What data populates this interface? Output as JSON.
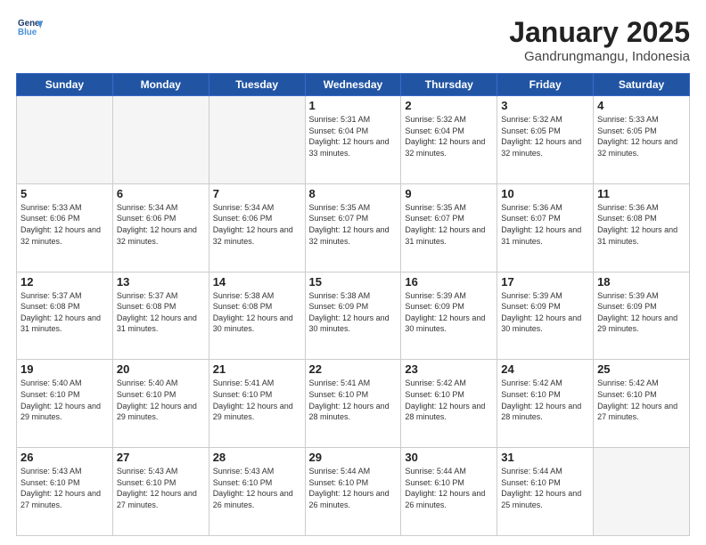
{
  "header": {
    "logo_line1": "General",
    "logo_line2": "Blue",
    "month": "January 2025",
    "location": "Gandrungmangu, Indonesia"
  },
  "weekdays": [
    "Sunday",
    "Monday",
    "Tuesday",
    "Wednesday",
    "Thursday",
    "Friday",
    "Saturday"
  ],
  "weeks": [
    [
      {
        "day": "",
        "info": ""
      },
      {
        "day": "",
        "info": ""
      },
      {
        "day": "",
        "info": ""
      },
      {
        "day": "1",
        "info": "Sunrise: 5:31 AM\nSunset: 6:04 PM\nDaylight: 12 hours\nand 33 minutes."
      },
      {
        "day": "2",
        "info": "Sunrise: 5:32 AM\nSunset: 6:04 PM\nDaylight: 12 hours\nand 32 minutes."
      },
      {
        "day": "3",
        "info": "Sunrise: 5:32 AM\nSunset: 6:05 PM\nDaylight: 12 hours\nand 32 minutes."
      },
      {
        "day": "4",
        "info": "Sunrise: 5:33 AM\nSunset: 6:05 PM\nDaylight: 12 hours\nand 32 minutes."
      }
    ],
    [
      {
        "day": "5",
        "info": "Sunrise: 5:33 AM\nSunset: 6:06 PM\nDaylight: 12 hours\nand 32 minutes."
      },
      {
        "day": "6",
        "info": "Sunrise: 5:34 AM\nSunset: 6:06 PM\nDaylight: 12 hours\nand 32 minutes."
      },
      {
        "day": "7",
        "info": "Sunrise: 5:34 AM\nSunset: 6:06 PM\nDaylight: 12 hours\nand 32 minutes."
      },
      {
        "day": "8",
        "info": "Sunrise: 5:35 AM\nSunset: 6:07 PM\nDaylight: 12 hours\nand 32 minutes."
      },
      {
        "day": "9",
        "info": "Sunrise: 5:35 AM\nSunset: 6:07 PM\nDaylight: 12 hours\nand 31 minutes."
      },
      {
        "day": "10",
        "info": "Sunrise: 5:36 AM\nSunset: 6:07 PM\nDaylight: 12 hours\nand 31 minutes."
      },
      {
        "day": "11",
        "info": "Sunrise: 5:36 AM\nSunset: 6:08 PM\nDaylight: 12 hours\nand 31 minutes."
      }
    ],
    [
      {
        "day": "12",
        "info": "Sunrise: 5:37 AM\nSunset: 6:08 PM\nDaylight: 12 hours\nand 31 minutes."
      },
      {
        "day": "13",
        "info": "Sunrise: 5:37 AM\nSunset: 6:08 PM\nDaylight: 12 hours\nand 31 minutes."
      },
      {
        "day": "14",
        "info": "Sunrise: 5:38 AM\nSunset: 6:08 PM\nDaylight: 12 hours\nand 30 minutes."
      },
      {
        "day": "15",
        "info": "Sunrise: 5:38 AM\nSunset: 6:09 PM\nDaylight: 12 hours\nand 30 minutes."
      },
      {
        "day": "16",
        "info": "Sunrise: 5:39 AM\nSunset: 6:09 PM\nDaylight: 12 hours\nand 30 minutes."
      },
      {
        "day": "17",
        "info": "Sunrise: 5:39 AM\nSunset: 6:09 PM\nDaylight: 12 hours\nand 30 minutes."
      },
      {
        "day": "18",
        "info": "Sunrise: 5:39 AM\nSunset: 6:09 PM\nDaylight: 12 hours\nand 29 minutes."
      }
    ],
    [
      {
        "day": "19",
        "info": "Sunrise: 5:40 AM\nSunset: 6:10 PM\nDaylight: 12 hours\nand 29 minutes."
      },
      {
        "day": "20",
        "info": "Sunrise: 5:40 AM\nSunset: 6:10 PM\nDaylight: 12 hours\nand 29 minutes."
      },
      {
        "day": "21",
        "info": "Sunrise: 5:41 AM\nSunset: 6:10 PM\nDaylight: 12 hours\nand 29 minutes."
      },
      {
        "day": "22",
        "info": "Sunrise: 5:41 AM\nSunset: 6:10 PM\nDaylight: 12 hours\nand 28 minutes."
      },
      {
        "day": "23",
        "info": "Sunrise: 5:42 AM\nSunset: 6:10 PM\nDaylight: 12 hours\nand 28 minutes."
      },
      {
        "day": "24",
        "info": "Sunrise: 5:42 AM\nSunset: 6:10 PM\nDaylight: 12 hours\nand 28 minutes."
      },
      {
        "day": "25",
        "info": "Sunrise: 5:42 AM\nSunset: 6:10 PM\nDaylight: 12 hours\nand 27 minutes."
      }
    ],
    [
      {
        "day": "26",
        "info": "Sunrise: 5:43 AM\nSunset: 6:10 PM\nDaylight: 12 hours\nand 27 minutes."
      },
      {
        "day": "27",
        "info": "Sunrise: 5:43 AM\nSunset: 6:10 PM\nDaylight: 12 hours\nand 27 minutes."
      },
      {
        "day": "28",
        "info": "Sunrise: 5:43 AM\nSunset: 6:10 PM\nDaylight: 12 hours\nand 26 minutes."
      },
      {
        "day": "29",
        "info": "Sunrise: 5:44 AM\nSunset: 6:10 PM\nDaylight: 12 hours\nand 26 minutes."
      },
      {
        "day": "30",
        "info": "Sunrise: 5:44 AM\nSunset: 6:10 PM\nDaylight: 12 hours\nand 26 minutes."
      },
      {
        "day": "31",
        "info": "Sunrise: 5:44 AM\nSunset: 6:10 PM\nDaylight: 12 hours\nand 25 minutes."
      },
      {
        "day": "",
        "info": ""
      }
    ]
  ]
}
